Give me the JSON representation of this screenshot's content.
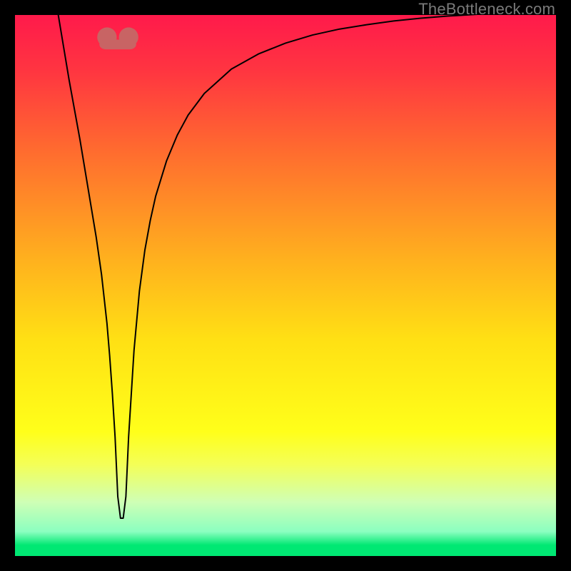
{
  "watermark": "TheBottleneck.com",
  "chart_data": {
    "type": "line",
    "title": "",
    "xlabel": "",
    "ylabel": "",
    "xlim": [
      0,
      100
    ],
    "ylim": [
      0,
      100
    ],
    "background_gradient_stops": [
      {
        "offset": 0.0,
        "color": "#ff1a4b"
      },
      {
        "offset": 0.1,
        "color": "#ff3441"
      },
      {
        "offset": 0.25,
        "color": "#ff6b2f"
      },
      {
        "offset": 0.45,
        "color": "#ffb01e"
      },
      {
        "offset": 0.6,
        "color": "#ffe014"
      },
      {
        "offset": 0.77,
        "color": "#ffff1a"
      },
      {
        "offset": 0.83,
        "color": "#f4ff56"
      },
      {
        "offset": 0.9,
        "color": "#cfffb5"
      },
      {
        "offset": 0.955,
        "color": "#8bffc0"
      },
      {
        "offset": 0.98,
        "color": "#00e873"
      },
      {
        "offset": 1.0,
        "color": "#00e873"
      }
    ],
    "nub": {
      "color": "#c86464",
      "x_center": 19,
      "y": 96.5,
      "width": 4,
      "height": 3
    },
    "series": [
      {
        "name": "bottleneck-curve",
        "x": [
          8,
          9,
          10,
          11,
          12,
          13,
          14,
          15,
          16,
          17,
          17.5,
          18,
          18.5,
          19,
          19.5,
          20,
          20.5,
          21,
          22,
          23,
          24,
          25,
          26,
          28,
          30,
          32,
          35,
          40,
          45,
          50,
          55,
          60,
          65,
          70,
          75,
          80,
          85,
          90,
          95,
          100
        ],
        "y": [
          100,
          94,
          88,
          82.5,
          77,
          71,
          65,
          59,
          52,
          43,
          37,
          30,
          22,
          11,
          7,
          7,
          11,
          22,
          38,
          49,
          56.5,
          62,
          66.5,
          73,
          77.8,
          81.5,
          85.5,
          90,
          92.8,
          94.8,
          96.3,
          97.4,
          98.2,
          98.9,
          99.4,
          99.8,
          100.1,
          100.4,
          100.6,
          100.8
        ],
        "y_inverted_note": "y=0 bottom, y=100 top; values slightly >100 exit top edge",
        "stroke": "#000000",
        "stroke_width": 2
      }
    ]
  }
}
